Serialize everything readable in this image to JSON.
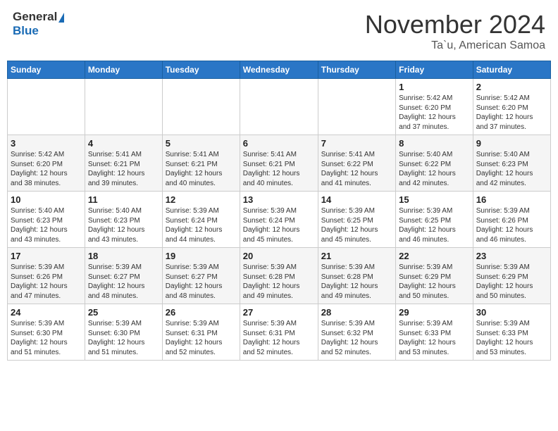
{
  "header": {
    "logo_general": "General",
    "logo_blue": "Blue",
    "month": "November 2024",
    "location": "Ta`u, American Samoa"
  },
  "weekdays": [
    "Sunday",
    "Monday",
    "Tuesday",
    "Wednesday",
    "Thursday",
    "Friday",
    "Saturday"
  ],
  "weeks": [
    [
      {
        "day": "",
        "info": ""
      },
      {
        "day": "",
        "info": ""
      },
      {
        "day": "",
        "info": ""
      },
      {
        "day": "",
        "info": ""
      },
      {
        "day": "",
        "info": ""
      },
      {
        "day": "1",
        "info": "Sunrise: 5:42 AM\nSunset: 6:20 PM\nDaylight: 12 hours\nand 37 minutes."
      },
      {
        "day": "2",
        "info": "Sunrise: 5:42 AM\nSunset: 6:20 PM\nDaylight: 12 hours\nand 37 minutes."
      }
    ],
    [
      {
        "day": "3",
        "info": "Sunrise: 5:42 AM\nSunset: 6:20 PM\nDaylight: 12 hours\nand 38 minutes."
      },
      {
        "day": "4",
        "info": "Sunrise: 5:41 AM\nSunset: 6:21 PM\nDaylight: 12 hours\nand 39 minutes."
      },
      {
        "day": "5",
        "info": "Sunrise: 5:41 AM\nSunset: 6:21 PM\nDaylight: 12 hours\nand 40 minutes."
      },
      {
        "day": "6",
        "info": "Sunrise: 5:41 AM\nSunset: 6:21 PM\nDaylight: 12 hours\nand 40 minutes."
      },
      {
        "day": "7",
        "info": "Sunrise: 5:41 AM\nSunset: 6:22 PM\nDaylight: 12 hours\nand 41 minutes."
      },
      {
        "day": "8",
        "info": "Sunrise: 5:40 AM\nSunset: 6:22 PM\nDaylight: 12 hours\nand 42 minutes."
      },
      {
        "day": "9",
        "info": "Sunrise: 5:40 AM\nSunset: 6:23 PM\nDaylight: 12 hours\nand 42 minutes."
      }
    ],
    [
      {
        "day": "10",
        "info": "Sunrise: 5:40 AM\nSunset: 6:23 PM\nDaylight: 12 hours\nand 43 minutes."
      },
      {
        "day": "11",
        "info": "Sunrise: 5:40 AM\nSunset: 6:23 PM\nDaylight: 12 hours\nand 43 minutes."
      },
      {
        "day": "12",
        "info": "Sunrise: 5:39 AM\nSunset: 6:24 PM\nDaylight: 12 hours\nand 44 minutes."
      },
      {
        "day": "13",
        "info": "Sunrise: 5:39 AM\nSunset: 6:24 PM\nDaylight: 12 hours\nand 45 minutes."
      },
      {
        "day": "14",
        "info": "Sunrise: 5:39 AM\nSunset: 6:25 PM\nDaylight: 12 hours\nand 45 minutes."
      },
      {
        "day": "15",
        "info": "Sunrise: 5:39 AM\nSunset: 6:25 PM\nDaylight: 12 hours\nand 46 minutes."
      },
      {
        "day": "16",
        "info": "Sunrise: 5:39 AM\nSunset: 6:26 PM\nDaylight: 12 hours\nand 46 minutes."
      }
    ],
    [
      {
        "day": "17",
        "info": "Sunrise: 5:39 AM\nSunset: 6:26 PM\nDaylight: 12 hours\nand 47 minutes."
      },
      {
        "day": "18",
        "info": "Sunrise: 5:39 AM\nSunset: 6:27 PM\nDaylight: 12 hours\nand 48 minutes."
      },
      {
        "day": "19",
        "info": "Sunrise: 5:39 AM\nSunset: 6:27 PM\nDaylight: 12 hours\nand 48 minutes."
      },
      {
        "day": "20",
        "info": "Sunrise: 5:39 AM\nSunset: 6:28 PM\nDaylight: 12 hours\nand 49 minutes."
      },
      {
        "day": "21",
        "info": "Sunrise: 5:39 AM\nSunset: 6:28 PM\nDaylight: 12 hours\nand 49 minutes."
      },
      {
        "day": "22",
        "info": "Sunrise: 5:39 AM\nSunset: 6:29 PM\nDaylight: 12 hours\nand 50 minutes."
      },
      {
        "day": "23",
        "info": "Sunrise: 5:39 AM\nSunset: 6:29 PM\nDaylight: 12 hours\nand 50 minutes."
      }
    ],
    [
      {
        "day": "24",
        "info": "Sunrise: 5:39 AM\nSunset: 6:30 PM\nDaylight: 12 hours\nand 51 minutes."
      },
      {
        "day": "25",
        "info": "Sunrise: 5:39 AM\nSunset: 6:30 PM\nDaylight: 12 hours\nand 51 minutes."
      },
      {
        "day": "26",
        "info": "Sunrise: 5:39 AM\nSunset: 6:31 PM\nDaylight: 12 hours\nand 52 minutes."
      },
      {
        "day": "27",
        "info": "Sunrise: 5:39 AM\nSunset: 6:31 PM\nDaylight: 12 hours\nand 52 minutes."
      },
      {
        "day": "28",
        "info": "Sunrise: 5:39 AM\nSunset: 6:32 PM\nDaylight: 12 hours\nand 52 minutes."
      },
      {
        "day": "29",
        "info": "Sunrise: 5:39 AM\nSunset: 6:33 PM\nDaylight: 12 hours\nand 53 minutes."
      },
      {
        "day": "30",
        "info": "Sunrise: 5:39 AM\nSunset: 6:33 PM\nDaylight: 12 hours\nand 53 minutes."
      }
    ]
  ]
}
